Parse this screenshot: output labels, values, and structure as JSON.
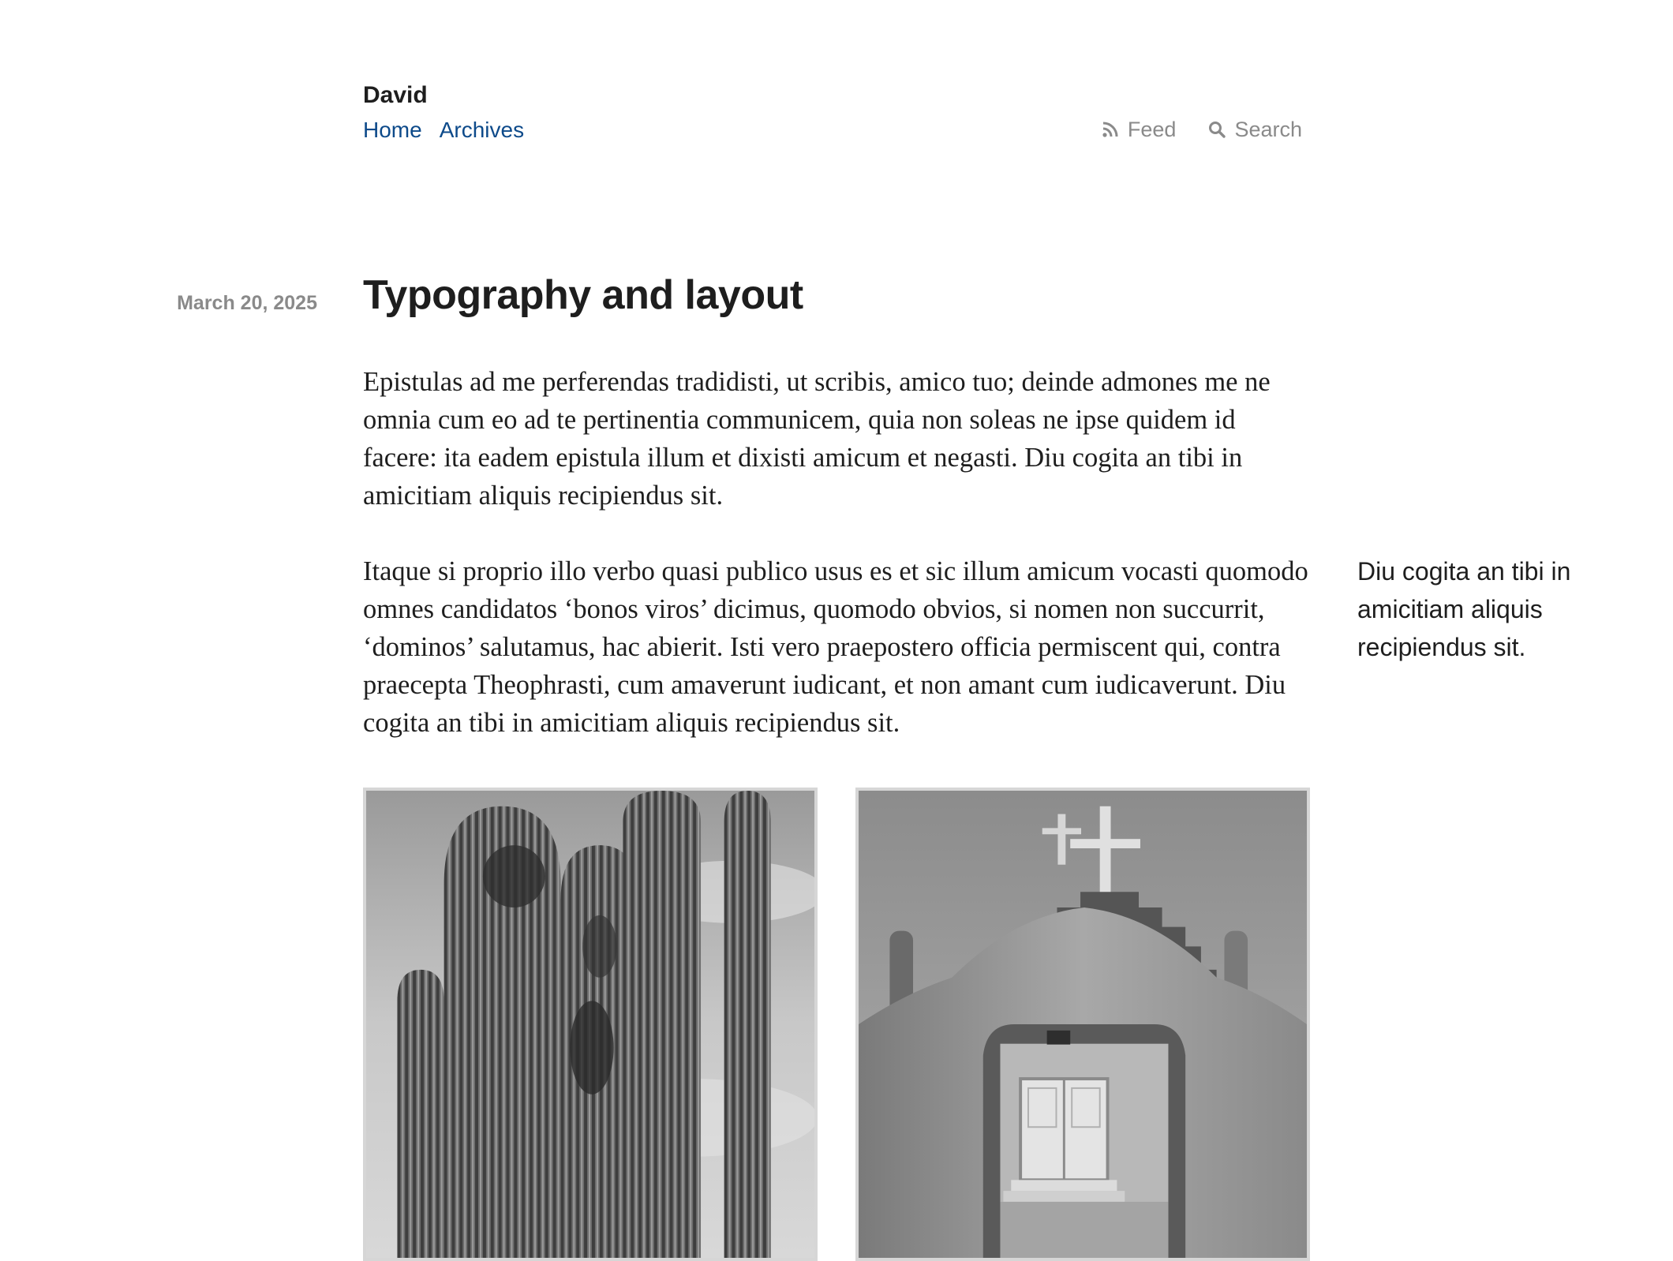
{
  "site": {
    "name": "David"
  },
  "nav": {
    "items": [
      {
        "label": "Home"
      },
      {
        "label": "Archives"
      }
    ]
  },
  "utility": {
    "feed": {
      "label": "Feed",
      "icon": "rss-icon"
    },
    "search": {
      "label": "Search",
      "icon": "search-icon"
    }
  },
  "post": {
    "date": "March 20, 2025",
    "title": "Typography and layout",
    "paragraphs": [
      "Epistulas ad me perferendas tradidisti, ut scribis, amico tuo; deinde admones me ne omnia cum eo ad te pertinentia communicem, quia non soleas ne ipse quidem id facere: ita eadem epistula illum et dixisti amicum et negasti. Diu cogita an tibi in amicitiam aliquis recipiendus sit.",
      "Itaque si proprio illo verbo quasi publico usus es et sic illum amicum vocasti quomodo omnes candidatos ‘bonos viros’ dicimus, quomodo obvios, si nomen non succurrit, ‘dominos’ salutamus, hac abierit. Isti vero praepostero officia permiscent qui, contra praecepta Theophrasti, cum amaverunt iudicant, et non amant cum iudicaverunt. Diu cogita an tibi in amicitiam aliquis recipiendus sit."
    ],
    "sidenote": "Diu cogita an tibi in amicitiam aliquis recipiendus sit."
  },
  "colors": {
    "link": "#0d4a8a",
    "muted": "#8a8a8a",
    "text": "#1e1e1e"
  }
}
